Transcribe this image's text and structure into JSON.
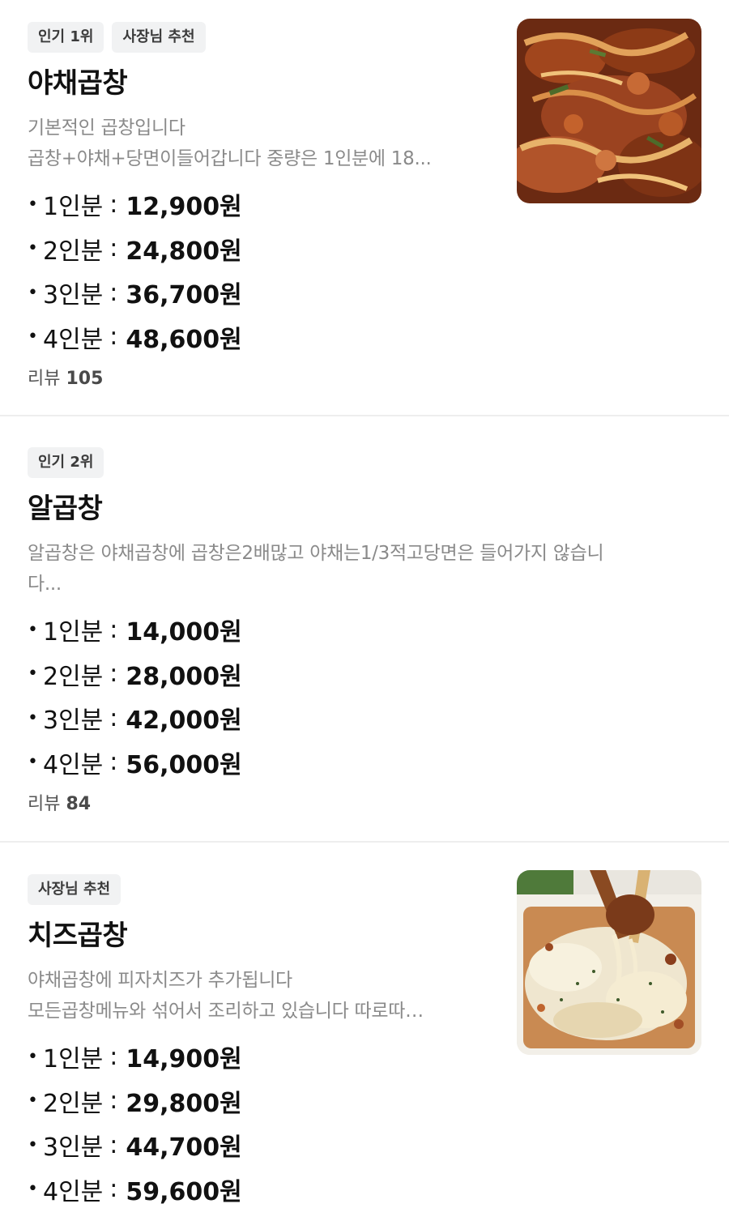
{
  "menu": [
    {
      "badges": [
        "인기 1위",
        "사장님 추천"
      ],
      "name": "야채곱창",
      "desc_lines": [
        "기본적인 곱창입니다",
        "곱창+야채+당면이들어갑니다  중량은 1인분에 18..."
      ],
      "prices": [
        {
          "portion": "1인분",
          "amount": "12,900원"
        },
        {
          "portion": "2인분",
          "amount": "24,800원"
        },
        {
          "portion": "3인분",
          "amount": "36,700원"
        },
        {
          "portion": "4인분",
          "amount": "48,600원"
        }
      ],
      "review_label": "리뷰",
      "review_count": "105",
      "image": "spicy-stir-fried-gopchang-photo"
    },
    {
      "badges": [
        "인기 2위"
      ],
      "name": "알곱창",
      "desc_lines": [
        "알곱창은 야채곱창에 곱창은2배많고 야채는1/3적고당면은 들어가지 않습니",
        "다..."
      ],
      "prices": [
        {
          "portion": "1인분",
          "amount": "14,000원"
        },
        {
          "portion": "2인분",
          "amount": "28,000원"
        },
        {
          "portion": "3인분",
          "amount": "42,000원"
        },
        {
          "portion": "4인분",
          "amount": "56,000원"
        }
      ],
      "review_label": "리뷰",
      "review_count": "84"
    },
    {
      "badges": [
        "사장님 추천"
      ],
      "name": "치즈곱창",
      "desc_lines": [
        "야채곱창에 피자치즈가 추가됩니다",
        "모든곱창메뉴와 섞어서 조리하고 있습니다 따로따…"
      ],
      "prices": [
        {
          "portion": "1인분",
          "amount": "14,900원"
        },
        {
          "portion": "2인분",
          "amount": "29,800원"
        },
        {
          "portion": "3인분",
          "amount": "44,700원"
        },
        {
          "portion": "4인분",
          "amount": "59,600원"
        }
      ],
      "image": "cheese-gopchang-photo"
    }
  ],
  "bullet": "•",
  "colon": ":",
  "colors": {
    "badge_bg": "#f1f2f3",
    "description": "#8a8a8a",
    "divider": "#eeeeee"
  }
}
